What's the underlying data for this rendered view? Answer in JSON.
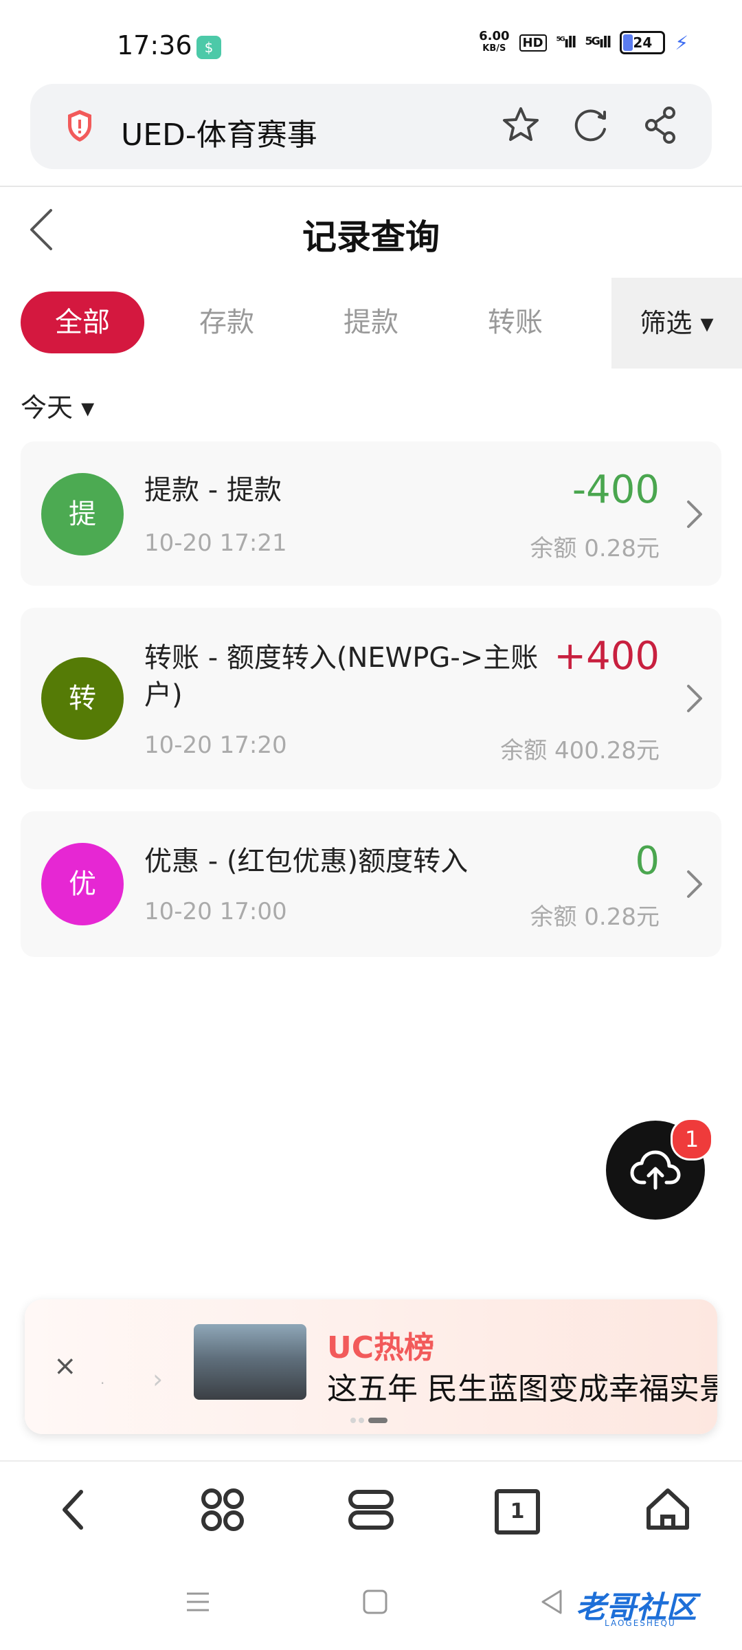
{
  "status": {
    "time": "17:36",
    "app_badge": "$",
    "net_speed": "6.00",
    "net_unit": "KB/S",
    "hd": "HD",
    "signal1": "⁵ᴳ",
    "signal2": "5G",
    "battery": "24"
  },
  "urlbar": {
    "title": "UED-体育赛事"
  },
  "page": {
    "title": "记录查询"
  },
  "tabs": {
    "all": "全部",
    "deposit": "存款",
    "withdraw": "提款",
    "transfer": "转账",
    "filter": "筛选 ▾"
  },
  "date_filter": "今天 ▾",
  "records": [
    {
      "avatar": "提",
      "avatar_color": "#4caa52",
      "title": "提款 - 提款",
      "time": "10-20 17:21",
      "amount": "-400",
      "amount_color": "#4aa64f",
      "balance": "余额 0.28元"
    },
    {
      "avatar": "转",
      "avatar_color": "#557b06",
      "title": "转账 - 额度转入(NEWPG->主账户)",
      "time": "10-20 17:20",
      "amount": "+400",
      "amount_color": "#c8203f",
      "balance": "余额 400.28元"
    },
    {
      "avatar": "优",
      "avatar_color": "#e627d3",
      "title": "优惠 - (红包优惠)额度转入",
      "time": "10-20 17:00",
      "amount": "0",
      "amount_color": "#4aa64f",
      "balance": "余额 0.28元"
    }
  ],
  "fab": {
    "badge": "1"
  },
  "banner": {
    "close": "×",
    "dot": "·",
    "chev": "›",
    "brand": "UC热榜",
    "headline": "这五年 民生蓝图变成幸福实景"
  },
  "bottom_nav": {
    "tab_count": "1"
  },
  "watermark": {
    "main": "老哥社区",
    "sub": "LAOGESHEQU"
  },
  "icons": [
    "shield-icon",
    "star-icon",
    "refresh-icon",
    "share-icon",
    "back-icon",
    "chevron-right-icon",
    "cloud-upload-icon",
    "nav-back-icon",
    "apps-icon",
    "menu-icon",
    "tabs-icon",
    "home-icon"
  ]
}
